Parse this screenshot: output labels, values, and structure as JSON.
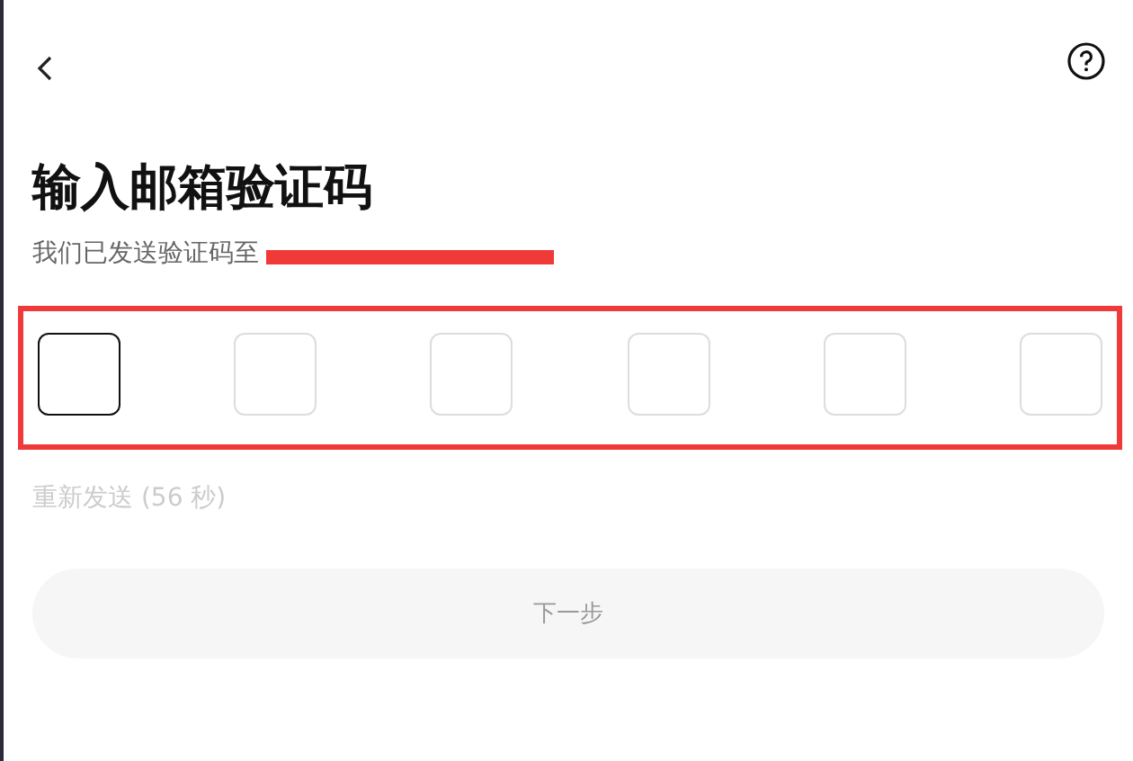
{
  "title": "输入邮箱验证码",
  "subtitle": "我们已发送验证码至",
  "email_redacted": true,
  "code_boxes": [
    {
      "selected": true
    },
    {
      "selected": false
    },
    {
      "selected": false
    },
    {
      "selected": false
    },
    {
      "selected": false
    },
    {
      "selected": false
    }
  ],
  "code_highlighted": true,
  "resend": {
    "label": "重新发送 (56 秒)",
    "disabled": true
  },
  "next_button": {
    "label": "下一步",
    "disabled": true
  }
}
